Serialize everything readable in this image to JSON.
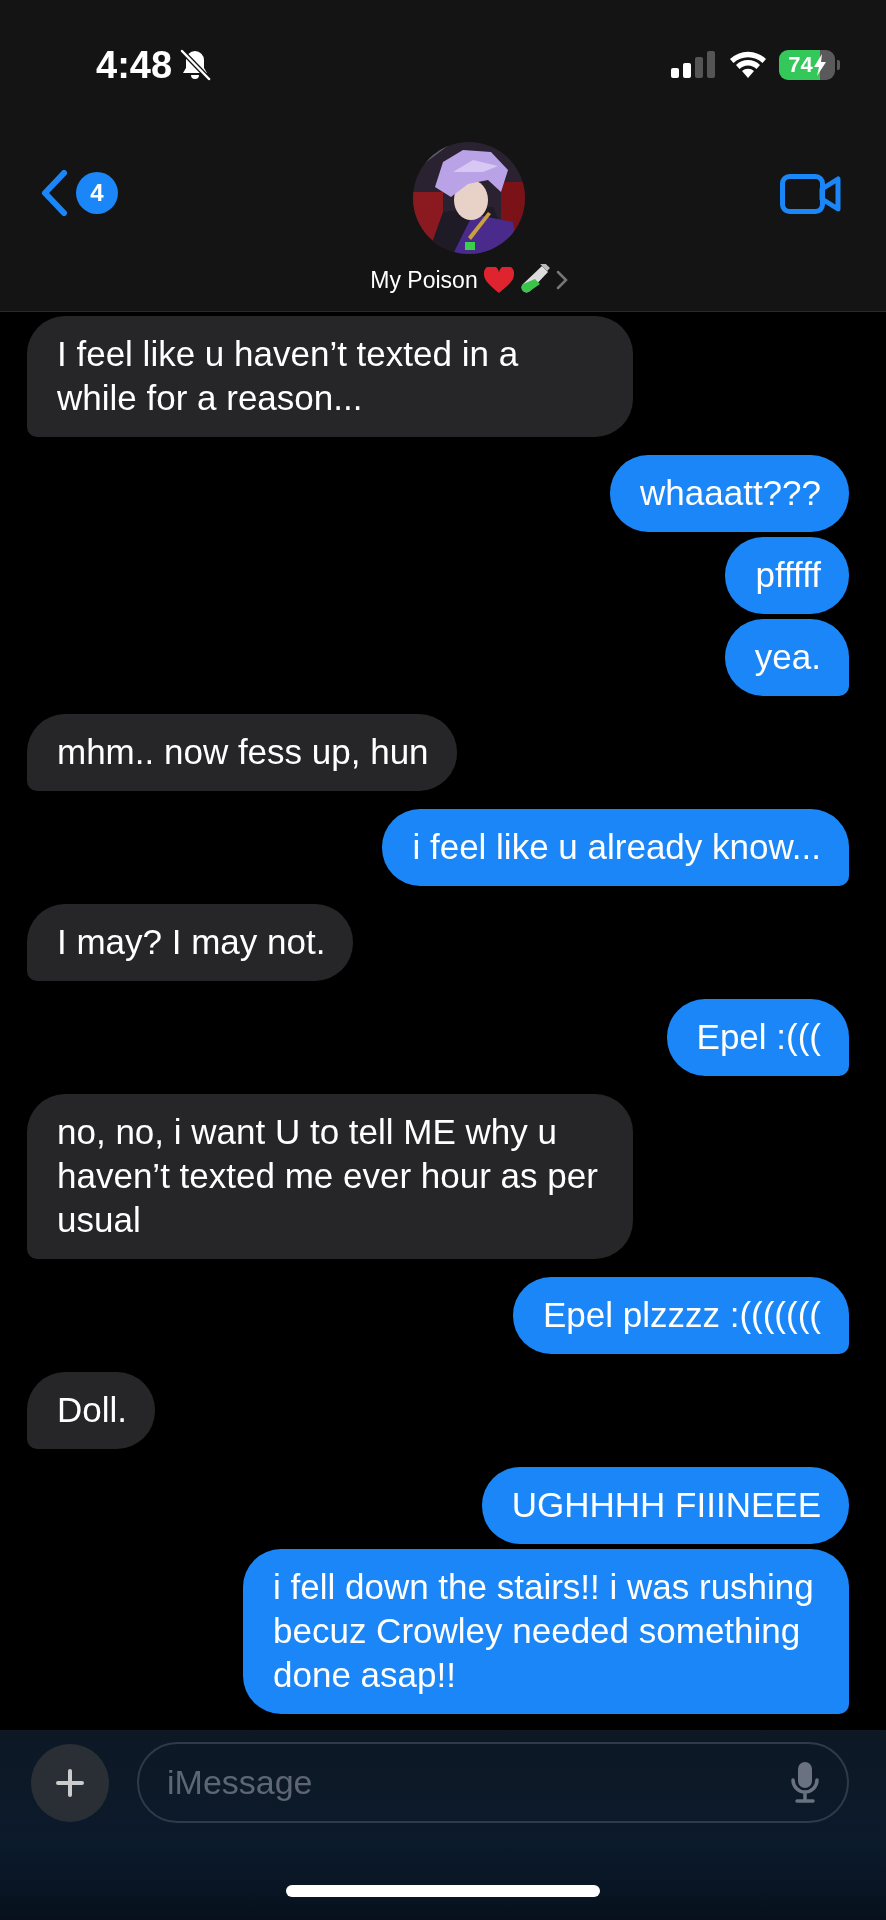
{
  "status_bar": {
    "time": "4:48",
    "silent": true,
    "battery": "74",
    "charging": true
  },
  "header": {
    "back_badge": "4",
    "contact_name": "My Poison"
  },
  "messages": [
    {
      "kind": "received",
      "text": "I feel like u haven’t texted in a while for a reason..."
    },
    {
      "kind": "sent",
      "text": "whaaatt???"
    },
    {
      "kind": "sent",
      "text": "pfffff"
    },
    {
      "kind": "sent",
      "text": "yea."
    },
    {
      "kind": "received",
      "text": "mhm.. now fess up, hun"
    },
    {
      "kind": "sent",
      "text": "i feel like u already know..."
    },
    {
      "kind": "received",
      "text": "I may? I may not."
    },
    {
      "kind": "sent",
      "text": "Epel :((("
    },
    {
      "kind": "received",
      "text": "no, no, i want U to tell ME why u haven’t texted me ever hour as per usual"
    },
    {
      "kind": "sent",
      "text": "Epel plzzzz :((((((("
    },
    {
      "kind": "received",
      "text": "Doll."
    },
    {
      "kind": "sent",
      "text": "UGHHHH FIIINEEE"
    },
    {
      "kind": "sent",
      "text": "i fell down the stairs!! i was rushing becuz Crowley needed something done asap!!"
    }
  ],
  "composer": {
    "placeholder": "iMessage"
  }
}
